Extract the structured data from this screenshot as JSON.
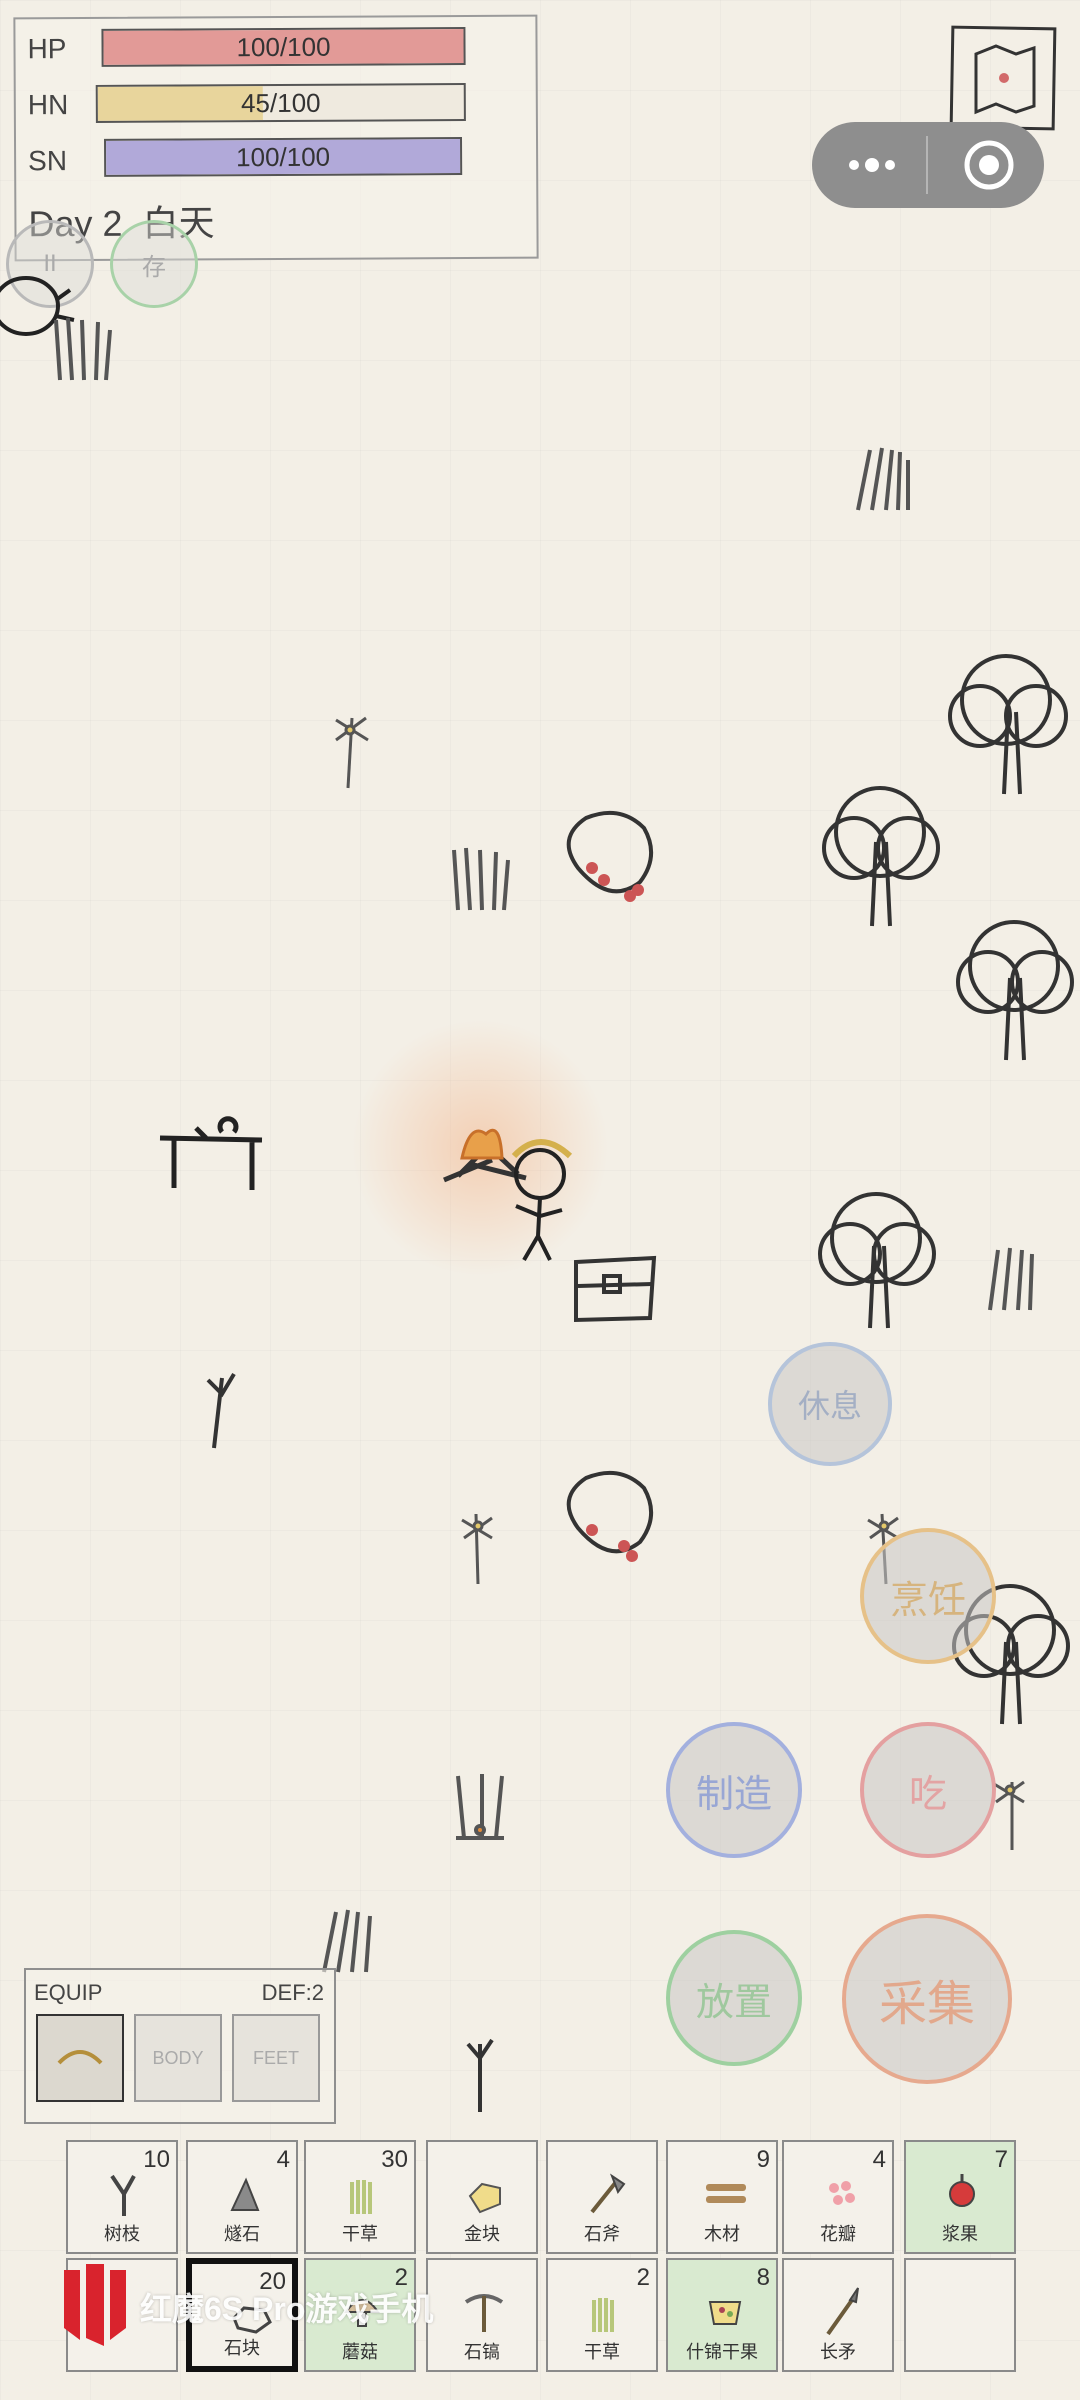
{
  "status": {
    "hp": {
      "label": "HP",
      "value": "100/100",
      "fraction": 1.0,
      "color": "#e29a97"
    },
    "hn": {
      "label": "HN",
      "value": "45/100",
      "fraction": 0.45,
      "color": "#e8d59c"
    },
    "sn": {
      "label": "SN",
      "value": "100/100",
      "fraction": 1.0,
      "color": "#b1a9d9"
    },
    "day": "Day 2",
    "time_of_day": "白天"
  },
  "quick_buttons": {
    "pause": "II",
    "save": "存"
  },
  "actions": {
    "rest": "休息",
    "cook": "烹饪",
    "craft": "制造",
    "eat": "吃",
    "place": "放置",
    "gather": "采集"
  },
  "equip": {
    "title": "EQUIP",
    "def": "DEF:2",
    "body": "BODY",
    "feet": "FEET"
  },
  "inventory_row1": [
    {
      "name": "树枝",
      "count": "10",
      "icon": "twig-icon"
    },
    {
      "name": "燧石",
      "count": "4",
      "icon": "flint-icon"
    },
    {
      "name": "干草",
      "count": "30",
      "icon": "grass-icon"
    },
    {
      "name": "金块",
      "count": "",
      "icon": "gold-nugget-icon"
    },
    {
      "name": "石斧",
      "count": "",
      "icon": "stone-axe-icon"
    },
    {
      "name": "木材",
      "count": "9",
      "icon": "wood-icon"
    },
    {
      "name": "花瓣",
      "count": "4",
      "icon": "petals-icon"
    },
    {
      "name": "浆果",
      "count": "7",
      "icon": "berry-icon"
    }
  ],
  "inventory_row2": [
    {
      "name": "",
      "count": "",
      "icon": ""
    },
    {
      "name": "石块",
      "count": "20",
      "icon": "rock-icon"
    },
    {
      "name": "蘑菇",
      "count": "2",
      "icon": "mushroom-icon"
    },
    {
      "name": "石镐",
      "count": "",
      "icon": "pickaxe-icon"
    },
    {
      "name": "干草",
      "count": "2",
      "icon": "grass-icon"
    },
    {
      "name": "什锦干果",
      "count": "8",
      "icon": "trail-mix-icon"
    },
    {
      "name": "长矛",
      "count": "",
      "icon": "spear-icon"
    },
    {
      "name": "",
      "count": "",
      "icon": ""
    }
  ],
  "watermark": "红魔6S Pro游戏手机"
}
